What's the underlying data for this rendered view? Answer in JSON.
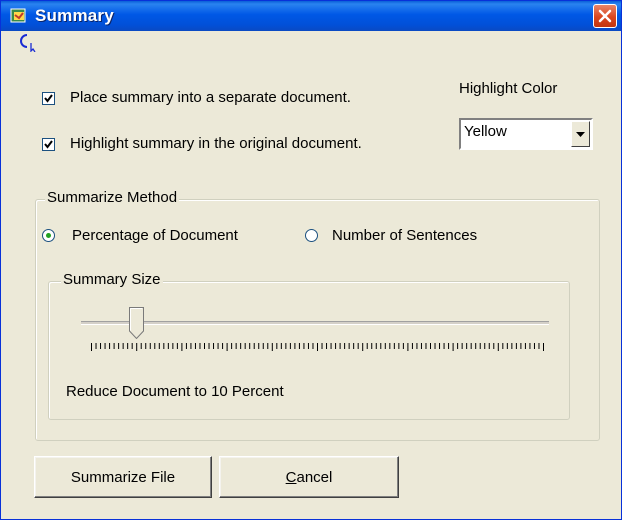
{
  "window": {
    "title": "Summary",
    "icon": "summary-app-icon",
    "close_icon": "close-icon"
  },
  "options": {
    "place_separate": {
      "label": "Place summary into a separate document.",
      "checked": true
    },
    "highlight_original": {
      "label": "Highlight summary in the original document.",
      "checked": true
    }
  },
  "highlight": {
    "label": "Highlight Color",
    "value": "Yellow"
  },
  "method": {
    "title": "Summarize Method",
    "percentage": {
      "label": "Percentage of Document",
      "selected": true
    },
    "sentences": {
      "label": "Number of Sentences",
      "selected": false
    }
  },
  "size": {
    "title": "Summary Size",
    "value_percent": 10,
    "caption": "Reduce Document to 10 Percent"
  },
  "buttons": {
    "summarize": "Summarize File",
    "cancel_first": "C",
    "cancel_rest": "ancel"
  },
  "colors": {
    "titlebar": "#0058e6",
    "window_bg": "#ece9d8",
    "close": "#d9461f",
    "radio_dot": "#21a121"
  }
}
